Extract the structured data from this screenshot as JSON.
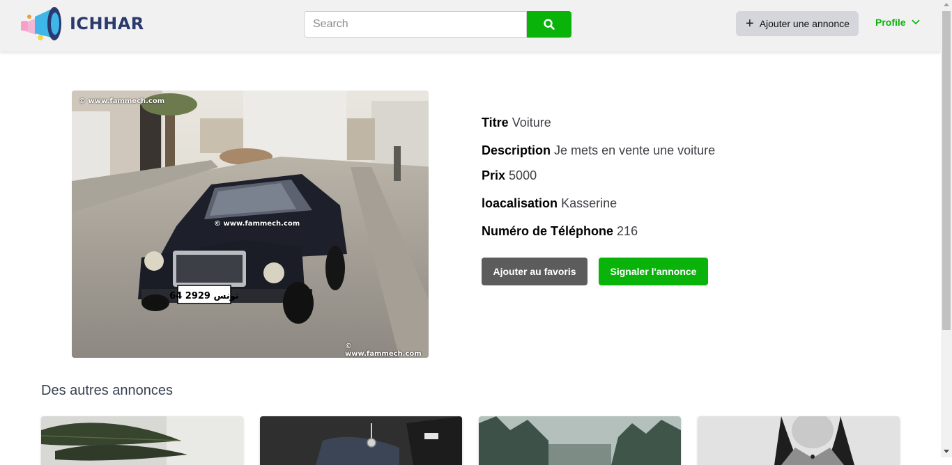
{
  "header": {
    "logo_text": "ICHHAR",
    "search": {
      "placeholder": "Search",
      "value": ""
    },
    "add_ad_label": "Ajouter une annonce",
    "profile_label": "Profile"
  },
  "ad": {
    "photo_watermark": "© www.fammech.com",
    "plate_text": "64 تونس 2929",
    "fields": [
      {
        "label": "Titre",
        "value": "Voiture"
      },
      {
        "label": "Description",
        "value": "Je mets en vente une voiture"
      },
      {
        "label": "Prix",
        "value": "5000"
      },
      {
        "label": "loacalisation",
        "value": "Kasserine"
      },
      {
        "label": "Numéro de Téléphone",
        "value": "216"
      }
    ],
    "favorite_button": "Ajouter au favoris",
    "report_button": "Signaler l'annonce"
  },
  "other_ads": {
    "title": "Des autres annonces",
    "cards": [
      {
        "image": "leaves-photo"
      },
      {
        "image": "clothes-watch-photo"
      },
      {
        "image": "forest-photo"
      },
      {
        "image": "woman-portrait-photo"
      }
    ]
  },
  "colors": {
    "accent_green": "#0ab30a",
    "dark_button": "#5c5c5c",
    "navbar_bg": "#f1f1f1"
  }
}
